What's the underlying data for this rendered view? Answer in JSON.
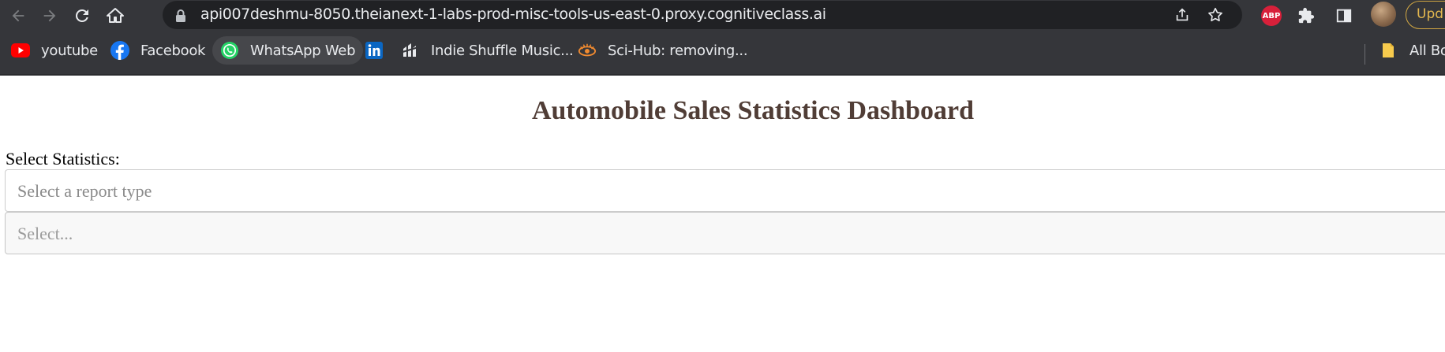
{
  "browser": {
    "url": "api007deshmu-8050.theianext-1-labs-prod-misc-tools-us-east-0.proxy.cognitiveclass.ai",
    "update_label": "Upd",
    "extensions": {
      "abp_label": "ABP"
    },
    "icons": [
      "back-icon",
      "forward-icon",
      "reload-icon",
      "home-icon",
      "lock-icon",
      "share-icon",
      "star-icon",
      "puzzle-icon",
      "sidepanel-icon"
    ]
  },
  "bookmarks": [
    {
      "label": "youtube",
      "icon": "youtube-icon"
    },
    {
      "label": "Facebook",
      "icon": "facebook-icon"
    },
    {
      "label": "WhatsApp Web",
      "icon": "whatsapp-icon"
    },
    {
      "label": "",
      "icon": "linkedin-icon"
    },
    {
      "label": "Indie Shuffle Music...",
      "icon": "indieshuffle-icon"
    },
    {
      "label": "Sci-Hub: removing...",
      "icon": "scihub-icon"
    }
  ],
  "bookmarks_all": "All Boo",
  "page": {
    "title": "Automobile Sales Statistics Dashboard",
    "statistics_label": "Select Statistics:",
    "report_select": {
      "placeholder": "Select a report type"
    },
    "year_select": {
      "placeholder": "Select..."
    }
  },
  "colors": {
    "title": "#503d36",
    "chrome_bg": "#35363a",
    "omnibox_bg": "#202124"
  }
}
